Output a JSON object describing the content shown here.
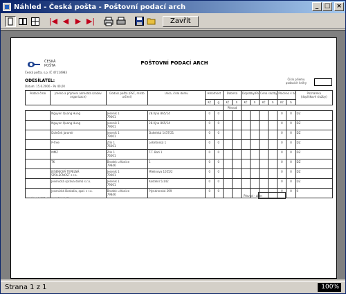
{
  "window": {
    "title": "Náhled - Česká pošta - Poštovní podací arch",
    "min": "_",
    "max": "□",
    "close": "×"
  },
  "toolbar": {
    "close_label": "Zavřít"
  },
  "doc": {
    "logo_text": [
      "ČESKÁ",
      "POŠTA"
    ],
    "company": "Česká pošta, s.p. IČ 47114983",
    "title": "POŠTOVNÍ PODACÍ ARCH",
    "sender_label": "ODESÍLATEL:",
    "date_line": "Datum: 15.6.2006 - Po 40,00",
    "number_label": "Číslo přiemu podacích knihy",
    "headers": {
      "c1": "Podací číslo",
      "c2": "Jméno a příjmení adresáta (název organizace)",
      "c3": "Dodací pošta (PSČ, místo určení)",
      "c4": "Ulice, číslo domu",
      "hmotnost": "Hmotnost",
      "dobirka": "Dobírka",
      "kg": "Kč",
      "g": "g",
      "kc": "Kč",
      "h": "h",
      "prevod": "Převod",
      "poukazka": "Doplatky/Poštovné",
      "cena": "Cena služby",
      "platne": "Placeno v hotovosti",
      "poznamka": "Poznámka",
      "poznamka_sub": "(doplňkové služby)"
    },
    "rows": [
      {
        "name": "Nguyen Quang Hung",
        "post": "Jeseník 1",
        "psc": "79001",
        "street": "28.října 865/14",
        "n1": "0",
        "n2": "0",
        "v1": "0",
        "v2": "0",
        "note": "DZ"
      },
      {
        "name": "Nguyen Quang Hung",
        "post": "Jeseník 1",
        "psc": "79001",
        "street": "28.října 865/14",
        "n1": "0",
        "n2": "0",
        "v1": "0",
        "v2": "0",
        "note": "DZ"
      },
      {
        "name": "Doleček Jaromír",
        "post": "Jeseník 1",
        "psc": "79001",
        "street": "Dukelská 1437/21",
        "n1": "0",
        "n2": "0",
        "v1": "0",
        "v2": "0",
        "note": "DZ"
      },
      {
        "name": "P-free",
        "post": "Zlín 1",
        "psc": "76001",
        "street": "Lešetínská 1",
        "n1": "0",
        "n2": "0",
        "v1": "0",
        "v2": "0",
        "note": "DZ"
      },
      {
        "name": "MMZ",
        "post": "Zlín 1",
        "psc": "76001",
        "street": "T.T. Bati 1",
        "n1": "0",
        "n2": "0",
        "v1": "0",
        "v2": "0",
        "note": "DZ"
      },
      {
        "name": "TK",
        "post": "Brodek u Konice",
        "psc": "79846",
        "street": "1",
        "n1": "0",
        "n2": "0",
        "v1": "0",
        "v2": "0",
        "note": "DZ"
      },
      {
        "name": "JESENICKÁ TEPELNÁ",
        "name2": "SPOLEČNOST s.r.o.",
        "post": "Jeseník 1",
        "psc": "79001",
        "street": "Mlelinova 1055/2",
        "n1": "0",
        "n2": "0",
        "v1": "0",
        "v2": "0",
        "note": "DZ"
      },
      {
        "name": "Jesenická správa domů s.r.o.",
        "post": "Jeseník 1",
        "psc": "79001",
        "street": "Kostelní 5/142",
        "n1": "0",
        "n2": "0",
        "v1": "0",
        "v2": "0",
        "note": "DZ"
      },
      {
        "name": "Jesenická Beskalia, spol. s r.o.",
        "post": "Brodek u Konice",
        "psc": "79846",
        "street": "Plynárenská 399",
        "n1": "0",
        "n2": "0",
        "v1": "0",
        "v2": "0",
        "note": "0"
      }
    ],
    "sum_label": "Převod - úhrn",
    "footer_note": "Rozesláno 1.6.2006 - Konec souboru 0 / Ø"
  },
  "status": {
    "page": "Strana 1 z 1",
    "zoom": "100%"
  }
}
